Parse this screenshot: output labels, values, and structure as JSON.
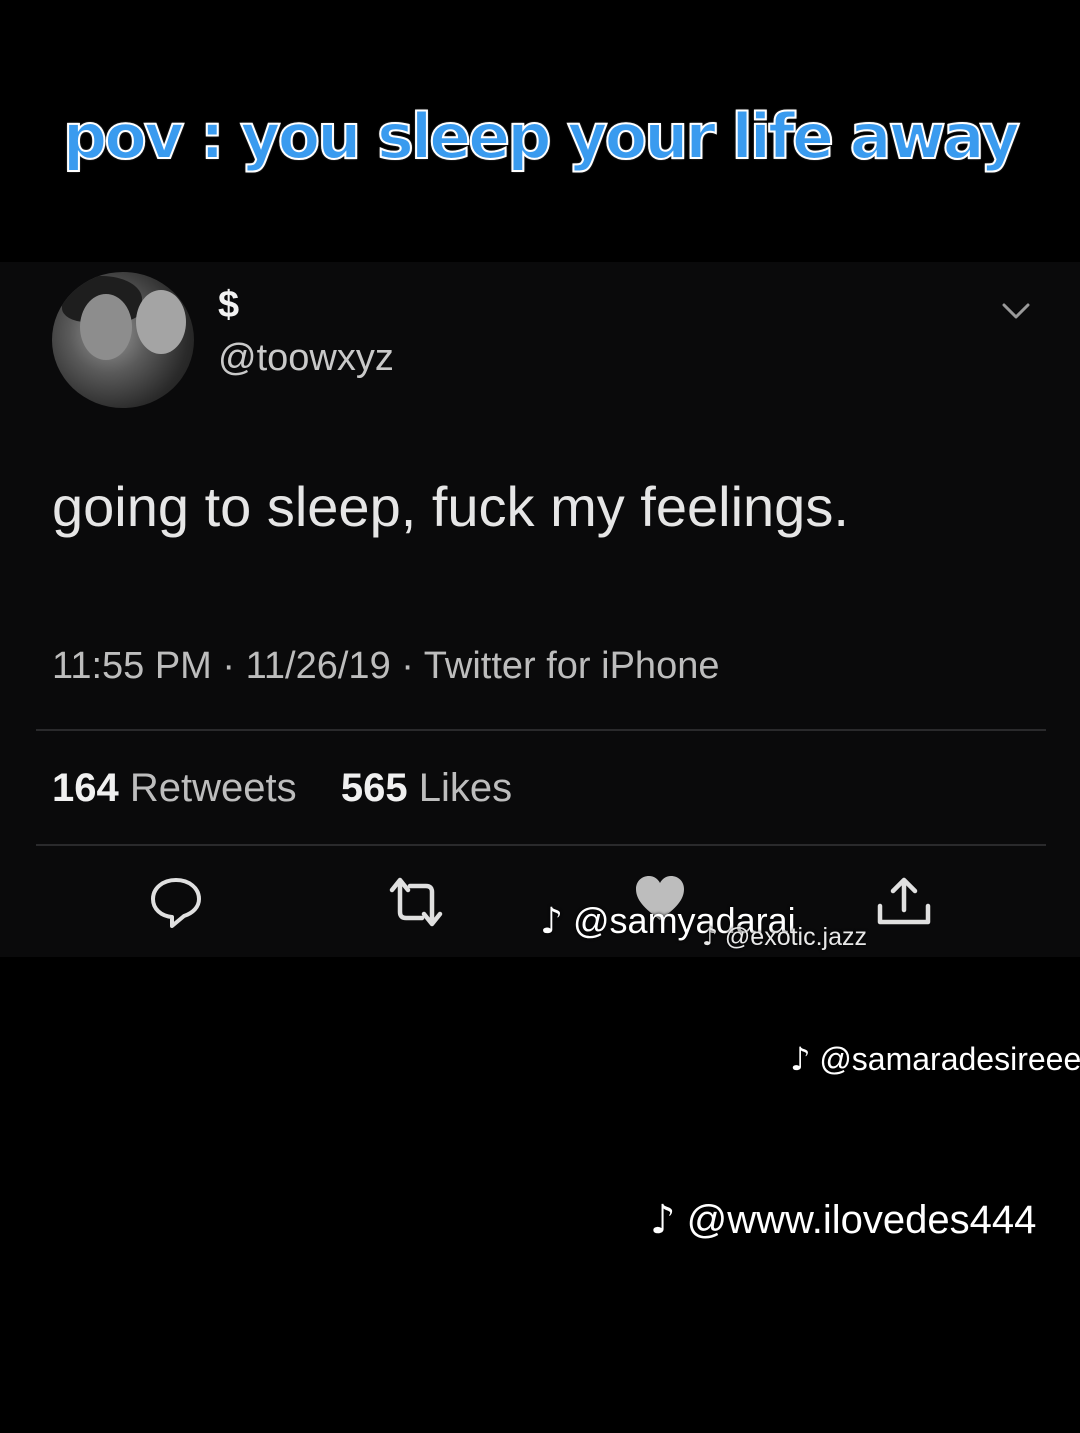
{
  "overlay": {
    "title": "pov : you sleep your life away"
  },
  "tweet": {
    "display_name": "$",
    "handle": "@toowxyz",
    "text": "going to sleep, fuck my feelings.",
    "meta": "11:55 PM · 11/26/19 · Twitter for iPhone",
    "stats": {
      "retweets_count": "164",
      "retweets_label": "Retweets",
      "likes_count": "565",
      "likes_label": "Likes"
    },
    "icons": [
      "reply-icon",
      "retweet-icon",
      "like-icon",
      "share-icon",
      "chevron-down-icon"
    ]
  },
  "watermarks": {
    "wm1": "@samyadarai",
    "wm2": "@exotic.jazz",
    "wm3": "@samaradesireee",
    "wm4": "@www.ilovedes444",
    "logo_glyph": "♪"
  },
  "colors": {
    "title_fill": "#3a9bef",
    "title_outline": "#ffffff",
    "background": "#000000",
    "card": "#0a0a0b"
  }
}
